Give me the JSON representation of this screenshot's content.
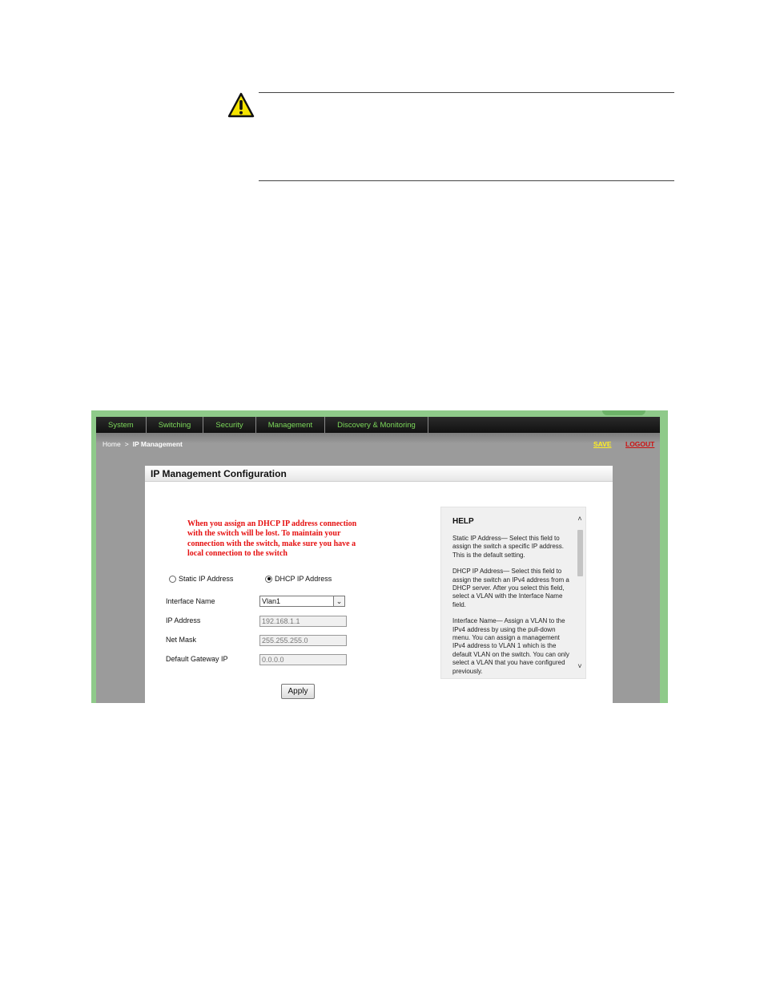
{
  "caution": {
    "icon": "caution-triangle-icon"
  },
  "nav": {
    "items": [
      "System",
      "Switching",
      "Security",
      "Management",
      "Discovery & Monitoring"
    ]
  },
  "breadcrumb": {
    "home": "Home",
    "separator": ">",
    "current": "IP Management"
  },
  "header_links": {
    "save": "SAVE",
    "logout": "LOGOUT"
  },
  "panel": {
    "title": "IP Management Configuration"
  },
  "warning": {
    "lines": [
      "When you assign an DHCP IP address connection",
      "with the switch will be lost. To maintain your",
      "connection with the switch, make sure you have a",
      "local connection to the switch"
    ]
  },
  "mode": {
    "static_label": "Static IP Address",
    "dhcp_label": "DHCP IP Address",
    "selected": "dhcp"
  },
  "form": {
    "interface_label": "Interface Name",
    "interface_value": "Vlan1",
    "ip_label": "IP Address",
    "ip_value": "192.168.1.1",
    "mask_label": "Net Mask",
    "mask_value": "255.255.255.0",
    "gateway_label": "Default Gateway IP",
    "gateway_value": "0.0.0.0",
    "apply_label": "Apply"
  },
  "help": {
    "title": "HELP",
    "paragraphs": [
      "Static IP Address— Select this field to assign the switch a specific IP address. This is the default setting.",
      "DHCP IP Address— Select this field to assign the switch an IPv4 address from a DHCP server. After you select this field, select a VLAN with the Interface Name field.",
      "Interface Name— Assign a VLAN to the IPv4 address by using the pull-down menu. You can assign a management IPv4 address to VLAN 1 which is the default VLAN on the switch. You can only select a VLAN that you have configured previously."
    ]
  },
  "colors": {
    "nav_text": "#7cd85a",
    "save": "#ffee22",
    "logout": "#cc1111",
    "warning": "#e51010",
    "frame": "#8fca8a"
  }
}
